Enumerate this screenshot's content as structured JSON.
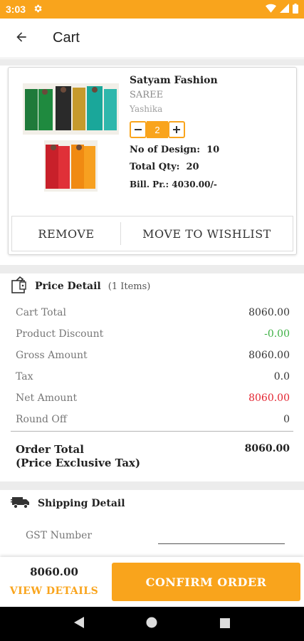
{
  "status_bar": {
    "time": "3:03"
  },
  "app_bar": {
    "title": "Cart"
  },
  "cart_item": {
    "brand": "Satyam Fashion",
    "category": "SAREE",
    "collection": "Yashika",
    "quantity": "2",
    "no_of_design_label": "No of Design:",
    "no_of_design_value": "10",
    "total_qty_label": "Total Qty:",
    "total_qty_value": "20",
    "bill_price_label": "Bill. Pr.:",
    "bill_price_value": "4030.00/-",
    "remove_label": "REMOVE",
    "wishlist_label": "MOVE TO WISHLIST"
  },
  "price_detail": {
    "title": "Price Detail",
    "items_count": "(1 Items)",
    "rows": [
      {
        "label": "Cart Total",
        "value": "8060.00"
      },
      {
        "label": "Product Discount",
        "value": "-0.00"
      },
      {
        "label": "Gross Amount",
        "value": "8060.00"
      },
      {
        "label": "Tax",
        "value": "0.0"
      },
      {
        "label": "Net Amount",
        "value": "8060.00"
      },
      {
        "label": "Round Off",
        "value": "0"
      }
    ],
    "order_total_label_1": "Order Total",
    "order_total_label_2": "(Price Exclusive Tax)",
    "order_total_value": "8060.00"
  },
  "shipping": {
    "title": "Shipping Detail",
    "gst_label": "GST Number",
    "gst_value": ""
  },
  "bottom_bar": {
    "total": "8060.00",
    "view_details": "VIEW DETAILS",
    "confirm": "CONFIRM ORDER"
  },
  "icons": {
    "settings": "gear-icon",
    "wifi": "wifi-icon",
    "signal": "signal-icon",
    "battery": "battery-icon",
    "back": "arrow-back-icon",
    "price": "price-tag-icon",
    "shipping": "truck-icon",
    "nav_back": "nav-back-icon",
    "nav_home": "nav-home-icon",
    "nav_recent": "nav-recents-icon"
  },
  "colors": {
    "accent": "#f9a41c",
    "discount": "#3cb043",
    "net_amount": "#e3222e",
    "background_band": "#ececec"
  }
}
